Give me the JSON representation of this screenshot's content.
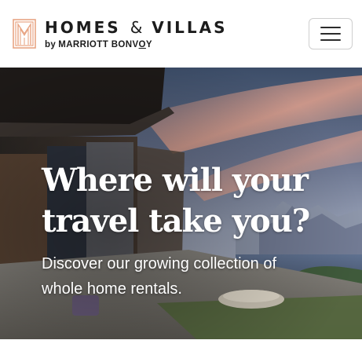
{
  "header": {
    "brand_name": "HOMES",
    "brand_amp": "&",
    "brand_name_2": "VILLAS",
    "brand_by": "by",
    "brand_sub": "MARRIOTT BONV",
    "brand_sub_o": "O",
    "brand_sub_end": "Y",
    "logo_icon": "homes-villas-monogram-icon",
    "menu_icon": "hamburger-menu-icon"
  },
  "hero": {
    "title_line1": "Where will your",
    "title_line2": "travel take you?",
    "subtitle_line1": "Discover our growing collection of",
    "subtitle_line2": "whole home rentals."
  },
  "colors": {
    "logo_accent": "#E8A584",
    "brand_text": "#1C1C1C",
    "hero_text": "#FFFFFF"
  }
}
